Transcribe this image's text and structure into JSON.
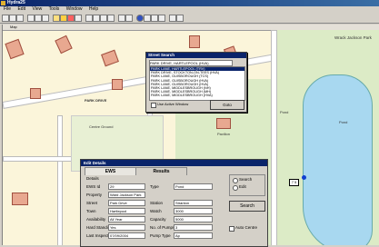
{
  "app": {
    "title": "Hydra25"
  },
  "menu": [
    "File",
    "Edit",
    "View",
    "Tools",
    "Window",
    "Help"
  ],
  "map": {
    "window_title": "Map",
    "labels": {
      "park_top": "Wrack Jackson Park",
      "pond_left": "Pond",
      "pond_right": "Pond",
      "center_ground": "Centre Ground",
      "pavilion": "Pavilion",
      "street_small": "PARK DRIVE",
      "marker": "7 5"
    }
  },
  "street_search": {
    "title": "Street Search",
    "input_value": "PARK DRIVE, HARTLEPOOL (HVA)",
    "items": [
      "PARK LANE, HARTLEPOOL (TRV)",
      "PARK DRIVE, STOCKTON-ON-TEES (HVA)",
      "PARK LANE, GUISBOROUGH (TCS)",
      "PARK LANE, GUISBOROUGH (HVA)",
      "PARK LANE, GUISBOROUGH (HVA)",
      "PARK LANE, MIDDLESBROUGH (NH)",
      "PARK LANE, MIDDLESBROUGH (MH)",
      "PARK LANE, MIDDLESBROUGH (HVA)"
    ],
    "selected_index": 0,
    "use_active_window": "Use Active Window",
    "goto_button": "Goto"
  },
  "edit_details": {
    "title": "Edit Details",
    "tabs": [
      "EWS",
      "Results"
    ],
    "section": "Details",
    "fields": {
      "ews_id_label": "EWS Id",
      "ews_id": "29",
      "type_label": "Type",
      "type": "Pond",
      "property_label": "Property",
      "property": "Ward Jackson Park",
      "street_label": "Street",
      "street": "Park Drive",
      "station_label": "Station",
      "station": "Stranton",
      "town_label": "Town",
      "town": "Hartlepool",
      "watch_label": "Watch",
      "watch": "3000",
      "availability_label": "Availability",
      "availability": "All Year",
      "capacity_label": "Capacity",
      "capacity": "5000",
      "hard_standing_label": "Hard Standing",
      "hard_standing": "Yes",
      "no_of_pumps_label": "No. of Pumps",
      "no_of_pumps": "3",
      "last_inspection_label": "Last Inspection",
      "last_inspection": "07/09/2004",
      "pump_type_label": "Pump Type",
      "pump_type": "Ap"
    },
    "search_radio": "Search",
    "edit_radio": "Edit",
    "search_button": "Search",
    "auto_centre": "Auto Centre"
  }
}
